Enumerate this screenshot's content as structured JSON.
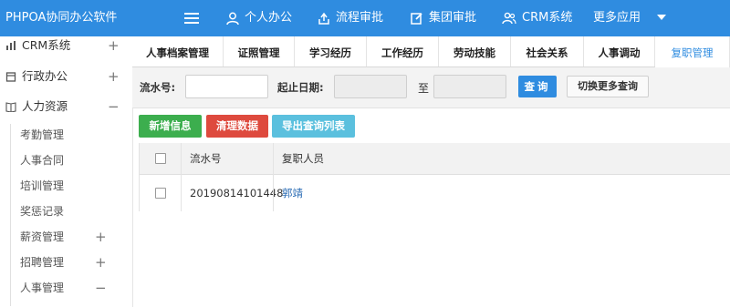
{
  "app": {
    "title": "PHPOA协同办公软件"
  },
  "topnav": [
    {
      "label": "个人办公",
      "icon": "user-icon"
    },
    {
      "label": "流程审批",
      "icon": "workflow-icon"
    },
    {
      "label": "集团审批",
      "icon": "edit-icon"
    },
    {
      "label": "CRM系统",
      "icon": "team-icon"
    },
    {
      "label": "更多应用"
    }
  ],
  "sidebar": {
    "items": [
      {
        "label": "CRM系统",
        "toggle": "+"
      },
      {
        "label": "行政办公",
        "toggle": "+"
      },
      {
        "label": "人力资源",
        "toggle": "−"
      }
    ],
    "subitems": [
      {
        "label": "考勤管理"
      },
      {
        "label": "人事合同"
      },
      {
        "label": "培训管理"
      },
      {
        "label": "奖惩记录"
      },
      {
        "label": "薪资管理",
        "toggle": "+"
      },
      {
        "label": "招聘管理",
        "toggle": "+"
      },
      {
        "label": "人事管理",
        "toggle": "−"
      }
    ]
  },
  "tabs": [
    {
      "label": "人事档案管理"
    },
    {
      "label": "证照管理"
    },
    {
      "label": "学习经历"
    },
    {
      "label": "工作经历"
    },
    {
      "label": "劳动技能"
    },
    {
      "label": "社会关系"
    },
    {
      "label": "人事调动"
    },
    {
      "label": "复职管理",
      "active": true
    }
  ],
  "search": {
    "serial_label": "流水号:",
    "serial_value": "",
    "date_label": "起止日期:",
    "date_sep": "至",
    "query_button": "查询",
    "more_button": "切换更多查询"
  },
  "actions": {
    "add": "新增信息",
    "clear": "清理数据",
    "export": "导出查询列表"
  },
  "table": {
    "columns": [
      "流水号",
      "复职人员"
    ],
    "rows": [
      {
        "serial": "20190814101448",
        "person": "郭靖"
      }
    ]
  },
  "colors": {
    "primary": "#2f8ce0",
    "success": "#3cae4e",
    "danger": "#de4a3e",
    "info": "#5bc0de"
  }
}
